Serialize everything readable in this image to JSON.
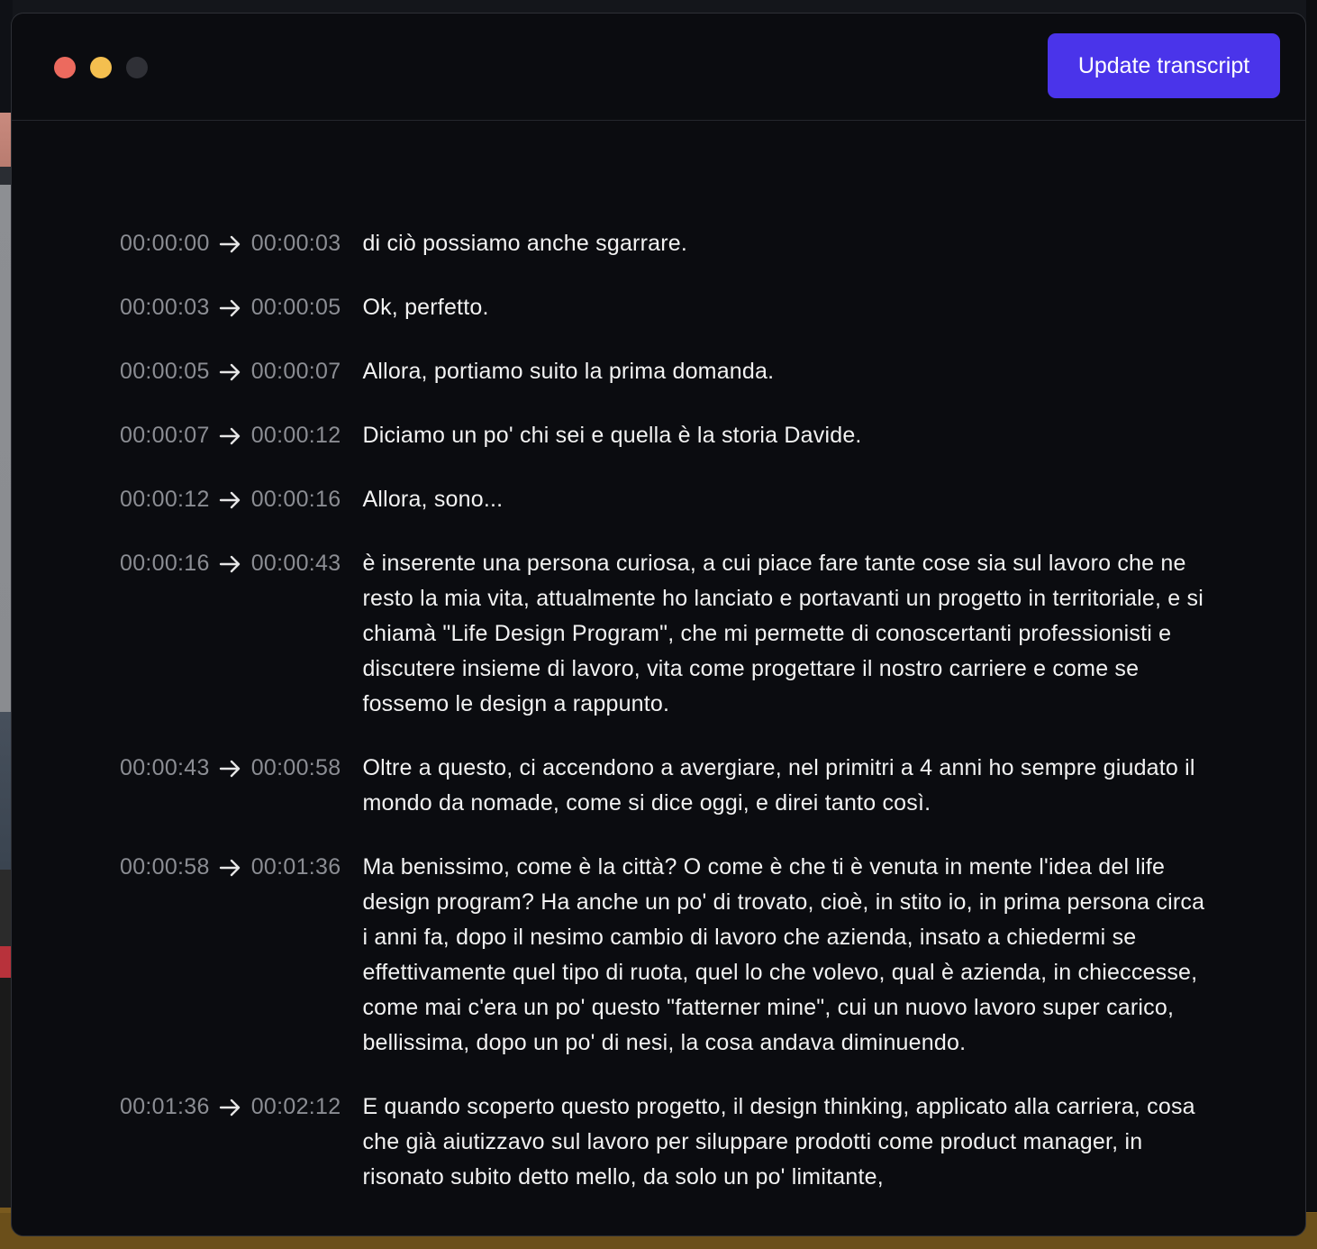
{
  "toolbar": {
    "update_label": "Update transcript"
  },
  "window_controls": {
    "close": "red",
    "minimize": "yellow",
    "zoom": "gray",
    "close_color": "#ec6a5e",
    "minimize_color": "#f4bf4f",
    "zoom_color": "#2f3036"
  },
  "colors": {
    "accent": "#4a34ea",
    "background": "#0b0c10",
    "timestamp": "#8b8d93",
    "text": "#f2f2f2"
  },
  "icons": {
    "arrow": "arrow-right-icon"
  },
  "transcript": [
    {
      "start": "00:00:00",
      "end": "00:00:03",
      "text": "di ciò possiamo anche sgarrare."
    },
    {
      "start": "00:00:03",
      "end": "00:00:05",
      "text": "Ok, perfetto."
    },
    {
      "start": "00:00:05",
      "end": "00:00:07",
      "text": "Allora, portiamo suito la prima domanda."
    },
    {
      "start": "00:00:07",
      "end": "00:00:12",
      "text": "Diciamo un po' chi sei e quella è la storia Davide."
    },
    {
      "start": "00:00:12",
      "end": "00:00:16",
      "text": "Allora, sono..."
    },
    {
      "start": "00:00:16",
      "end": "00:00:43",
      "text": "è inserente una persona curiosa, a cui piace fare tante cose sia sul lavoro che ne resto la mia vita, attualmente ho lanciato e portavanti un progetto in territoriale, e si chiamà \"Life Design Program\", che mi permette di conoscertanti professionisti e discutere insieme di lavoro, vita come progettare il nostro carriere e come se fossemo le design a rappunto."
    },
    {
      "start": "00:00:43",
      "end": "00:00:58",
      "text": "Oltre a questo, ci accendono a avergiare, nel primitri a 4 anni ho sempre giudato il mondo da nomade, come si dice oggi, e direi tanto così."
    },
    {
      "start": "00:00:58",
      "end": "00:01:36",
      "text": "Ma benissimo, come è la città? O come è che ti è venuta in mente l'idea del life design program? Ha anche un po' di trovato, cioè, in stito io, in prima persona circa i anni fa, dopo il nesimo cambio di lavoro che azienda, insato a chiedermi se effettivamente quel tipo di ruota, quel lo che volevo, qual è azienda, in chieccesse, come mai c'era un po' questo \"fatterner mine\", cui un nuovo lavoro super carico, bellissima, dopo un po' di nesi, la cosa andava diminuendo."
    },
    {
      "start": "00:01:36",
      "end": "00:02:12",
      "text": "E quando scoperto questo progetto, il design thinking, applicato alla carriera, cosa che già aiutizzavo sul lavoro per siluppare prodotti come product manager, in risonato subito detto mello, da solo un po' limitante,"
    }
  ]
}
